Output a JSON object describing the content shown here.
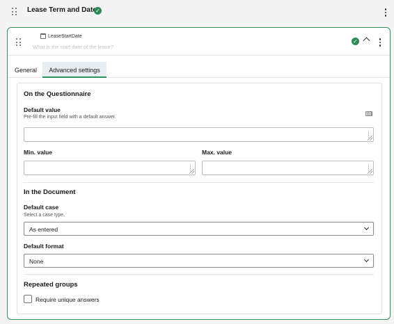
{
  "section": {
    "title": "Lease Term and Dates"
  },
  "field": {
    "name": "LeaseStartDate",
    "question_placeholder": "What is the start date of the lease?"
  },
  "tabs": [
    {
      "label": "General",
      "active": false
    },
    {
      "label": "Advanced settings",
      "active": true
    }
  ],
  "questionnaire": {
    "heading": "On the Questionnaire",
    "default_value": {
      "label": "Default value",
      "hint": "Pre-fill the input field with a default answer.",
      "value": ""
    },
    "min_value": {
      "label": "Min. value",
      "value": ""
    },
    "max_value": {
      "label": "Max. value",
      "value": ""
    }
  },
  "document": {
    "heading": "In the Document",
    "default_case": {
      "label": "Default case",
      "hint": "Select a case type.",
      "selected": "As entered"
    },
    "default_format": {
      "label": "Default format",
      "selected": "None"
    }
  },
  "repeated_groups": {
    "heading": "Repeated groups",
    "require_unique": {
      "label": "Require unique answers",
      "checked": false
    }
  },
  "colors": {
    "accent": "#2f8f5f",
    "check": "#2e8b57"
  }
}
